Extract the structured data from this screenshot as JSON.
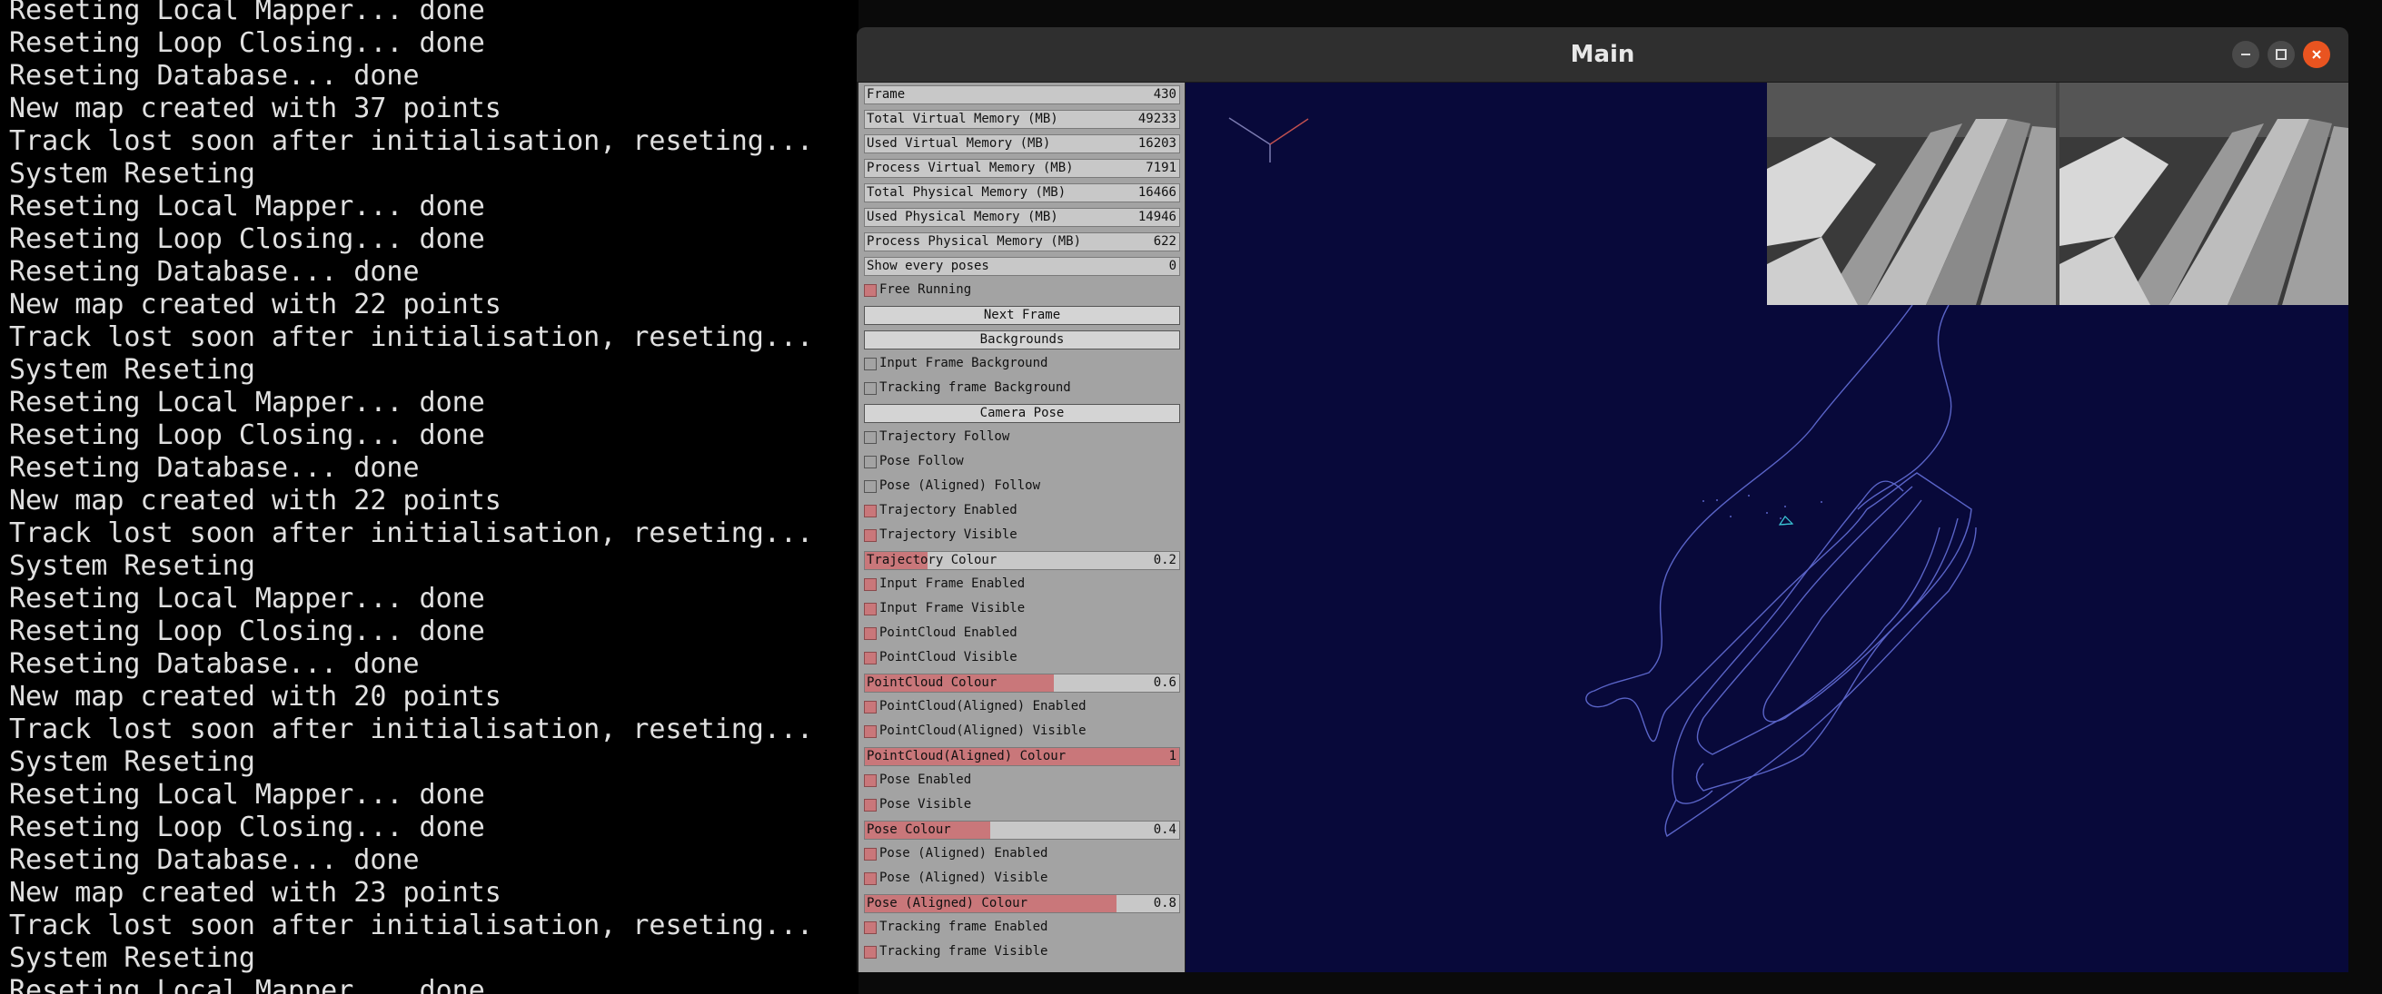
{
  "terminal": {
    "lines": [
      "Reseting Local Mapper... done",
      "Reseting Loop Closing... done",
      "Reseting Database... done",
      "New map created with 37 points",
      "Track lost soon after initialisation, reseting...",
      "System Reseting",
      "Reseting Local Mapper... done",
      "Reseting Loop Closing... done",
      "Reseting Database... done",
      "New map created with 22 points",
      "Track lost soon after initialisation, reseting...",
      "System Reseting",
      "Reseting Local Mapper... done",
      "Reseting Loop Closing... done",
      "Reseting Database... done",
      "New map created with 22 points",
      "Track lost soon after initialisation, reseting...",
      "System Reseting",
      "Reseting Local Mapper... done",
      "Reseting Loop Closing... done",
      "Reseting Database... done",
      "New map created with 20 points",
      "Track lost soon after initialisation, reseting...",
      "System Reseting",
      "Reseting Local Mapper... done",
      "Reseting Loop Closing... done",
      "Reseting Database... done",
      "New map created with 23 points",
      "Track lost soon after initialisation, reseting...",
      "System Reseting",
      "Reseting Local Mapper... done"
    ]
  },
  "window": {
    "title": "Main",
    "buttons": [
      "minimize-icon",
      "maximize-icon",
      "close-icon"
    ],
    "accent": "#e95420"
  },
  "panel": {
    "vars": [
      {
        "label": "Frame",
        "value": "430"
      },
      {
        "label": "Total Virtual Memory (MB)",
        "value": "49233"
      },
      {
        "label": "Used Virtual Memory (MB)",
        "value": "16203"
      },
      {
        "label": "Process Virtual Memory (MB)",
        "value": "7191"
      },
      {
        "label": "Total Physical Memory (MB)",
        "value": "16466"
      },
      {
        "label": "Used  Physical Memory (MB)",
        "value": "14946"
      },
      {
        "label": "Process Physical Memory (MB)",
        "value": "622"
      },
      {
        "label": "Show every poses",
        "value": "0"
      }
    ],
    "free_running": {
      "label": "Free Running",
      "checked": true
    },
    "next_frame": "Next Frame",
    "backgrounds": "Backgrounds",
    "input_frame_bg": {
      "label": "Input Frame Background",
      "checked": false
    },
    "tracking_frame_bg": {
      "label": "Tracking frame Background",
      "checked": false
    },
    "camera_pose": "Camera Pose",
    "trajectory_follow": {
      "label": "Trajectory Follow",
      "checked": false
    },
    "pose_follow": {
      "label": "Pose Follow",
      "checked": false
    },
    "pose_aligned_follow": {
      "label": "Pose (Aligned) Follow",
      "checked": false
    },
    "trajectory_enabled": {
      "label": "Trajectory Enabled",
      "checked": true
    },
    "trajectory_visible": {
      "label": "Trajectory Visible",
      "checked": true
    },
    "trajectory_colour": {
      "label": "Trajectory Colour",
      "value": "0.2",
      "level": 0.2
    },
    "input_frame_enabled": {
      "label": "Input Frame Enabled",
      "checked": true
    },
    "input_frame_visible": {
      "label": "Input Frame Visible",
      "checked": true
    },
    "pointcloud_enabled": {
      "label": "PointCloud Enabled",
      "checked": true
    },
    "pointcloud_visible": {
      "label": "PointCloud Visible",
      "checked": true
    },
    "pointcloud_colour": {
      "label": "PointCloud Colour",
      "value": "0.6",
      "level": 0.6
    },
    "pointcloud_aligned_enabled": {
      "label": "PointCloud(Aligned) Enabled",
      "checked": true
    },
    "pointcloud_aligned_visible": {
      "label": "PointCloud(Aligned) Visible",
      "checked": true
    },
    "pointcloud_aligned_colour": {
      "label": "PointCloud(Aligned) Colour",
      "value": "1",
      "level": 1.0
    },
    "pose_enabled": {
      "label": "Pose Enabled",
      "checked": true
    },
    "pose_visible": {
      "label": "Pose Visible",
      "checked": true
    },
    "pose_colour": {
      "label": "Pose Colour",
      "value": "0.4",
      "level": 0.4
    },
    "pose_aligned_enabled": {
      "label": "Pose (Aligned) Enabled",
      "checked": true
    },
    "pose_aligned_visible": {
      "label": "Pose (Aligned) Visible",
      "checked": true
    },
    "pose_aligned_colour": {
      "label": "Pose (Aligned) Colour",
      "value": "0.8",
      "level": 0.8
    },
    "tracking_frame_enabled": {
      "label": "Tracking frame Enabled",
      "checked": true
    },
    "tracking_frame_visible": {
      "label": "Tracking frame Visible",
      "checked": true
    }
  },
  "colors": {
    "panel_bg": "#a3a3a3",
    "slider_fill": "#c9777a",
    "viewport_bg": "#08093a",
    "trajectory": "#5a64c8"
  }
}
